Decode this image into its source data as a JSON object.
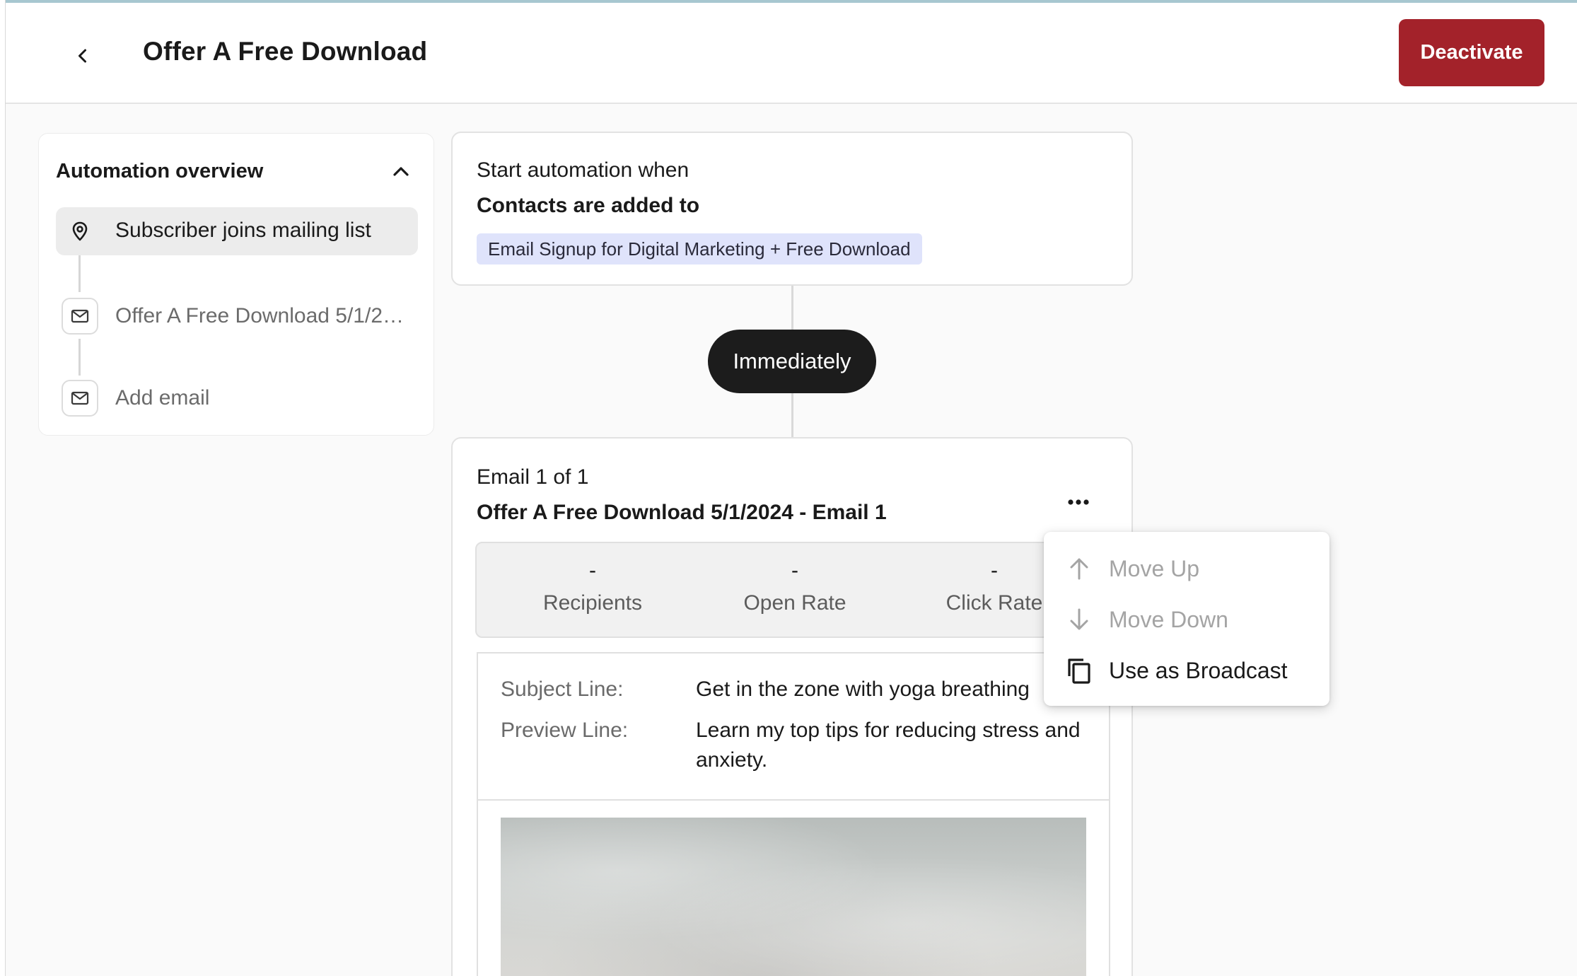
{
  "header": {
    "title": "Offer A Free Download",
    "deactivate_label": "Deactivate"
  },
  "overview": {
    "title": "Automation overview",
    "items": [
      {
        "label": "Subscriber joins mailing list",
        "icon": "map-pin-icon",
        "active": true
      },
      {
        "label": "Offer A Free Download 5/1/2024 - Email 1",
        "icon": "mail-icon",
        "active": false
      },
      {
        "label": "Add email",
        "icon": "mail-icon",
        "active": false
      }
    ]
  },
  "trigger": {
    "pre": "Start automation when",
    "condition": "Contacts are added to",
    "tag": "Email Signup for Digital Marketing + Free Download"
  },
  "delay": {
    "label": "Immediately"
  },
  "email": {
    "count": "Email 1 of 1",
    "name": "Offer A Free Download 5/1/2024 - Email 1",
    "stats": [
      {
        "value": "-",
        "label": "Recipients"
      },
      {
        "value": "-",
        "label": "Open Rate"
      },
      {
        "value": "-",
        "label": "Click Rate"
      }
    ],
    "subject_label": "Subject Line:",
    "subject_value": "Get in the zone with yoga breathing",
    "preview_label": "Preview Line:",
    "preview_value": "Learn my top tips for reducing stress and anxiety."
  },
  "menu": {
    "items": [
      {
        "label": "Move Up",
        "icon": "arrow-up-icon",
        "disabled": true
      },
      {
        "label": "Move Down",
        "icon": "arrow-down-icon",
        "disabled": true
      },
      {
        "label": "Use as Broadcast",
        "icon": "copy-icon",
        "disabled": false
      }
    ]
  },
  "colors": {
    "primary_danger": "#a3222a",
    "tag_background": "#dfe3fb",
    "pill_background": "#1c1c1c"
  }
}
